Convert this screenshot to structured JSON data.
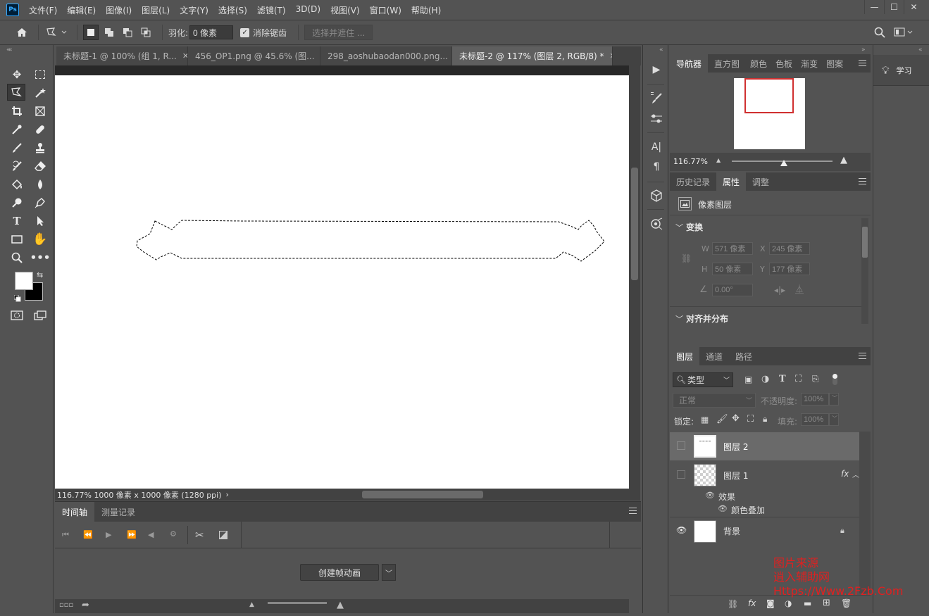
{
  "app": {
    "logo": "Ps",
    "menu": [
      "文件(F)",
      "编辑(E)",
      "图像(I)",
      "图层(L)",
      "文字(Y)",
      "选择(S)",
      "滤镜(T)",
      "3D(D)",
      "视图(V)",
      "窗口(W)",
      "帮助(H)"
    ],
    "window_buttons": [
      "—",
      "☐",
      "✕"
    ]
  },
  "options": {
    "feather_label": "羽化:",
    "feather_value": "0 像素",
    "antialias_label": "消除锯齿",
    "select_mask_label": "选择并遮住 ..."
  },
  "tabs": [
    {
      "label": "未标题-1 @ 100% (组 1, R...",
      "active": false
    },
    {
      "label": "456_OP1.png @ 45.6% (图...",
      "active": false
    },
    {
      "label": "298_aoshubaodan000.png...",
      "active": false
    },
    {
      "label": "未标题-2 @ 117% (图层 2, RGB/8) *",
      "active": true
    }
  ],
  "status": {
    "zoom_info": "116.77%  1000 像素 x 1000 像素 (1280 ppi)",
    "arrow": "›"
  },
  "timeline": {
    "tabs": [
      "时间轴",
      "测量记录"
    ],
    "create_button": "创建帧动画"
  },
  "navigator": {
    "tabs": [
      "导航器",
      "直方图",
      "颜色",
      "色板",
      "渐变",
      "图案"
    ],
    "zoom": "116.77%"
  },
  "properties": {
    "tabs": [
      "历史记录",
      "属性",
      "调整"
    ],
    "type_label": "像素图层",
    "transform_title": "变换",
    "w_label": "W",
    "w_value": "571 像素",
    "x_label": "X",
    "x_value": "245 像素",
    "h_label": "H",
    "h_value": "50 像素",
    "y_label": "Y",
    "y_value": "177 像素",
    "angle_value": "0.00°",
    "align_title": "对齐并分布"
  },
  "layers": {
    "tabs": [
      "图层",
      "通道",
      "路径"
    ],
    "filter_label": "类型",
    "blend_mode": "正常",
    "opacity_label": "不透明度:",
    "opacity_value": "100%",
    "lock_label": "锁定:",
    "fill_label": "填充:",
    "fill_value": "100%",
    "items": [
      {
        "name": "图层 2",
        "selected": true
      },
      {
        "name": "图层 1",
        "selected": false,
        "fx": "fx"
      },
      {
        "name": "背景",
        "selected": false
      }
    ],
    "effects_label": "效果",
    "color_overlay_label": "颜色叠加"
  },
  "learn": {
    "label": "学习"
  },
  "watermark": {
    "line1": "图片来源",
    "line2": "逍入辅助网",
    "line3": "Https://Www.2Fzb.Com"
  },
  "colors": {
    "accent_selection": "#d03030",
    "watermark": "#e02020"
  }
}
